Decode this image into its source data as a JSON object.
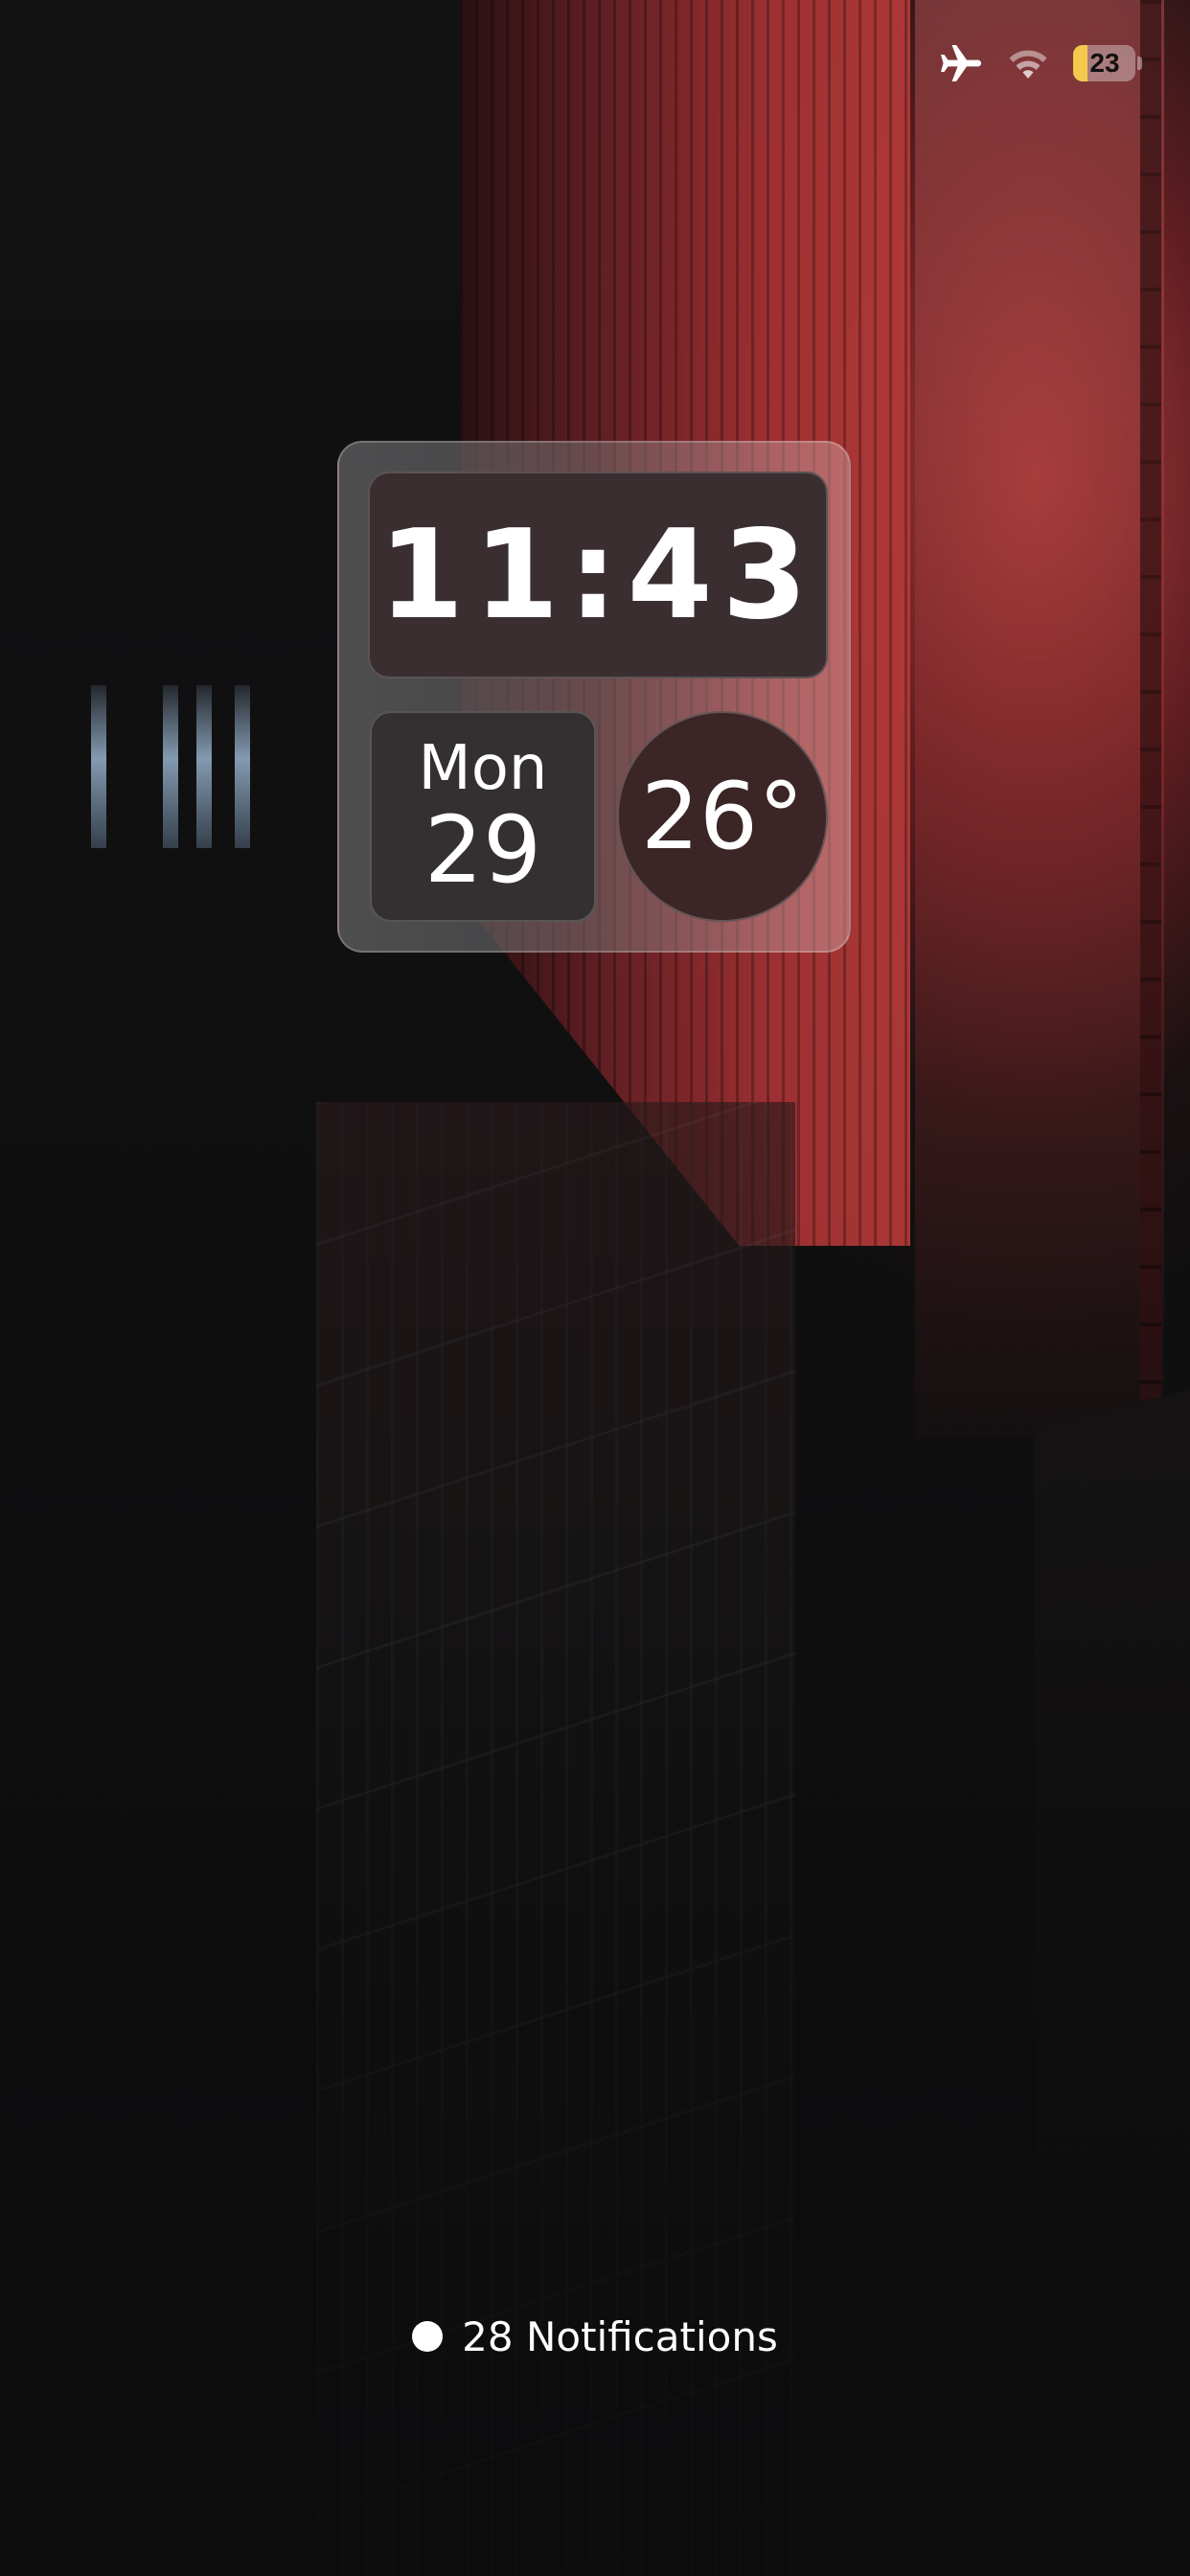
{
  "status_bar": {
    "airplane_icon": "airplane-icon",
    "wifi_icon": "wifi-icon",
    "battery_percent": "23",
    "battery_color": "#f2c94c",
    "battery_level": 0.23
  },
  "widget": {
    "time": "11:43",
    "day": "Mon",
    "date": "29",
    "temperature": "26°"
  },
  "notifications": {
    "label": "28 Notifications"
  },
  "colors": {
    "accent_red": "#b23a38",
    "widget_tile": "#3a2e30"
  }
}
